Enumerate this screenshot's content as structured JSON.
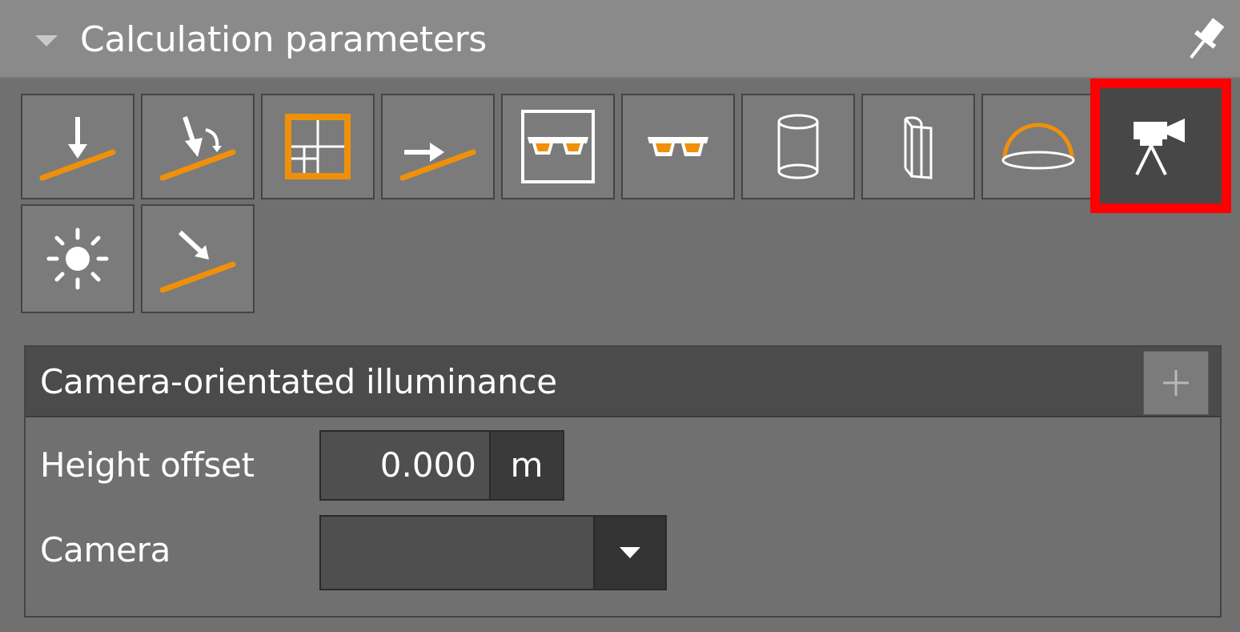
{
  "panel": {
    "title": "Calculation parameters"
  },
  "toolbar": {
    "tools": [
      {
        "name": "horizontal-illuminance",
        "icon": "arrow-down-plane-icon"
      },
      {
        "name": "inclined-illuminance",
        "icon": "arrow-tilt-plane-icon"
      },
      {
        "name": "grid-illuminance",
        "icon": "grid-frame-icon"
      },
      {
        "name": "vertical-illuminance",
        "icon": "arrow-right-plane-icon"
      },
      {
        "name": "glare-framed",
        "icon": "glasses-framed-icon"
      },
      {
        "name": "glare",
        "icon": "glasses-icon"
      },
      {
        "name": "cylindrical-illuminance",
        "icon": "cylinder-icon"
      },
      {
        "name": "semi-cylindrical-illuminance",
        "icon": "half-cylinder-icon"
      },
      {
        "name": "hemispherical-illuminance",
        "icon": "hemisphere-icon"
      },
      {
        "name": "camera-orientated-illuminance",
        "icon": "camera-tripod-icon",
        "active": true
      },
      {
        "name": "daylight",
        "icon": "sun-icon"
      },
      {
        "name": "directional-illuminance",
        "icon": "arrow-diagonal-plane-icon"
      }
    ],
    "active_highlight_color": "#ff0000",
    "accent_color": "#f0900a"
  },
  "section": {
    "title": "Camera-orientated illuminance",
    "add_label": "+",
    "height_offset": {
      "label": "Height offset",
      "value": "0.000",
      "unit": "m"
    },
    "camera": {
      "label": "Camera",
      "value": ""
    }
  }
}
